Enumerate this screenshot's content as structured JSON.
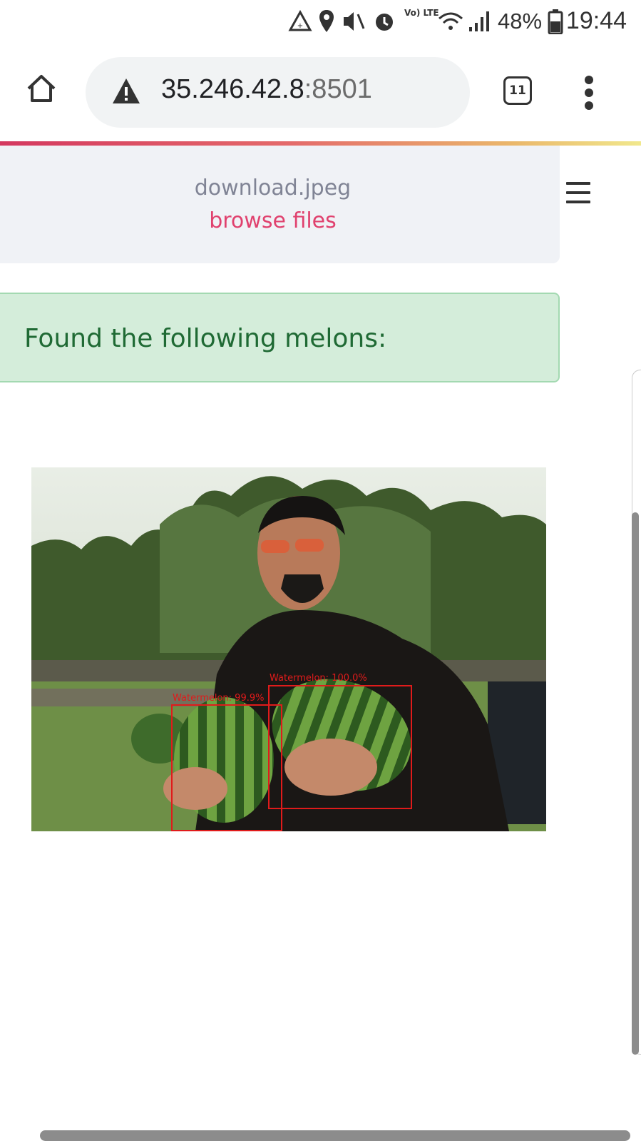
{
  "status_bar": {
    "lte_label": "Vo) LTE",
    "battery_percent": "48%",
    "time": "19:44"
  },
  "browser": {
    "url_host": "35.246.42.8",
    "url_port": ":8501",
    "tab_count": "11"
  },
  "uploader": {
    "file_name": "download.jpeg",
    "browse_label": "browse files"
  },
  "result": {
    "message": "Found the following melons:"
  },
  "detections": [
    {
      "label": "Watermelon: 100.0%"
    },
    {
      "label": "Watermelon: 99.9%"
    }
  ],
  "colors": {
    "accent": "#e0416e",
    "success_bg": "#d4edda",
    "success_text": "#1f6a34",
    "detection_box": "#e01b1b"
  }
}
